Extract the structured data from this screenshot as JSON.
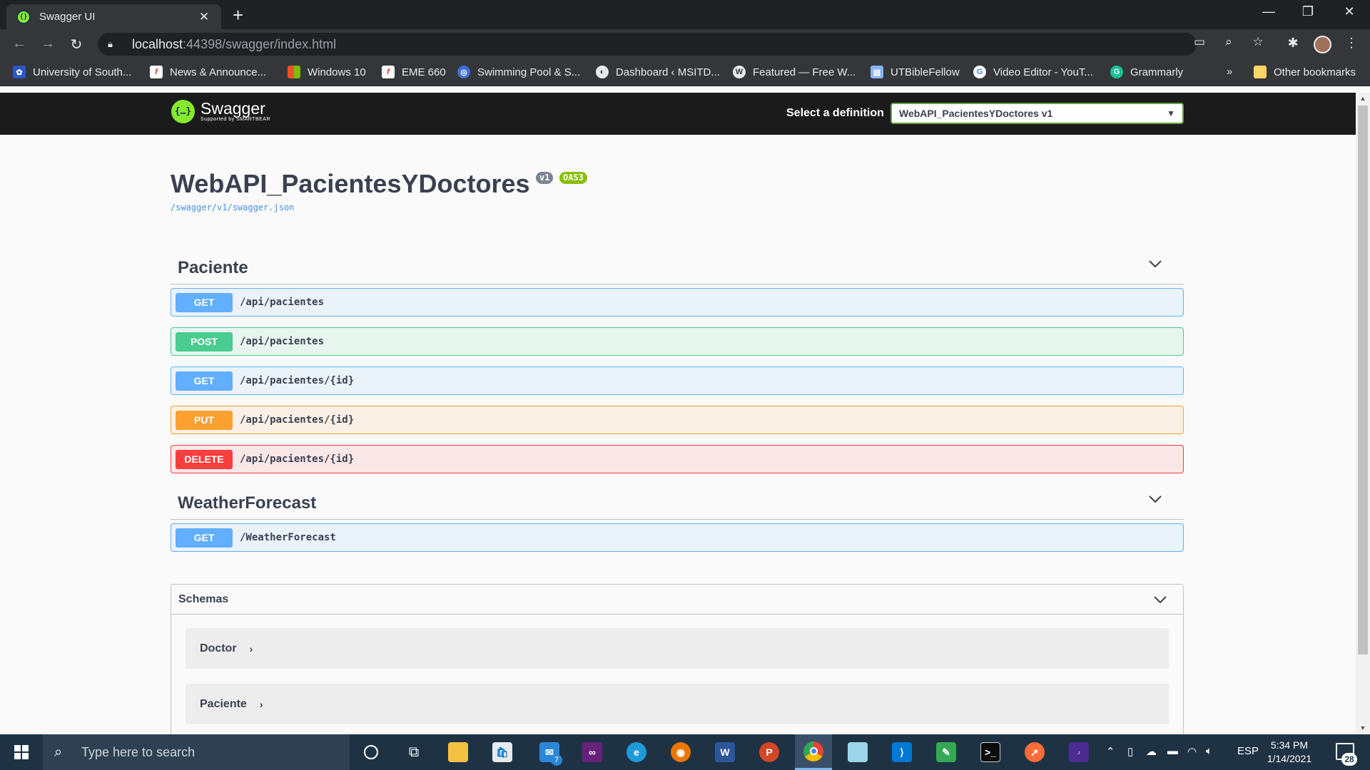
{
  "browser": {
    "tab_title": "Swagger UI",
    "url_host": "localhost",
    "url_rest": ":44398/swagger/index.html",
    "bookmarks": [
      {
        "label": "University of South...",
        "icon": "usf-icon",
        "color": "#2b57c4"
      },
      {
        "label": "News & Announce...",
        "icon": "news-icon",
        "color": "#d93025"
      },
      {
        "label": "Windows 10",
        "icon": "windows-icon",
        "color": "#f25022"
      },
      {
        "label": "EME 660",
        "icon": "course-icon",
        "color": "#d93025"
      },
      {
        "label": "Swimming Pool & S...",
        "icon": "globe-icon",
        "color": "#3c6ed8"
      },
      {
        "label": "Dashboard ‹ MSITD...",
        "icon": "dashboard-icon",
        "color": "#5f6368"
      },
      {
        "label": "Featured — Free W...",
        "icon": "wordpress-icon",
        "color": "#5f6368"
      },
      {
        "label": "UTBibleFellow",
        "icon": "document-icon",
        "color": "#8ab4f8"
      },
      {
        "label": "Video Editor - YouT...",
        "icon": "google-icon",
        "color": "#ffffff"
      },
      {
        "label": "Grammarly",
        "icon": "grammarly-icon",
        "color": "#15c39a"
      }
    ],
    "more_bookmarks": "»",
    "other_bookmarks": "Other bookmarks"
  },
  "swagger": {
    "brand": "Swagger",
    "brand_sub": "Supported by SMARTBEAR",
    "select_label": "Select a definition",
    "select_value": "WebAPI_PacientesYDoctores v1",
    "title": "WebAPI_PacientesYDoctores",
    "version_badge": "v1",
    "oas_badge": "OAS3",
    "spec_link": "/swagger/v1/swagger.json",
    "tags": [
      {
        "name": "Paciente",
        "operations": [
          {
            "method": "GET",
            "path": "/api/pacientes",
            "kind": "get"
          },
          {
            "method": "POST",
            "path": "/api/pacientes",
            "kind": "post"
          },
          {
            "method": "GET",
            "path": "/api/pacientes/{id}",
            "kind": "get"
          },
          {
            "method": "PUT",
            "path": "/api/pacientes/{id}",
            "kind": "put"
          },
          {
            "method": "DELETE",
            "path": "/api/pacientes/{id}",
            "kind": "delete"
          }
        ]
      },
      {
        "name": "WeatherForecast",
        "operations": [
          {
            "method": "GET",
            "path": "/WeatherForecast",
            "kind": "get"
          }
        ]
      }
    ],
    "schemas": {
      "title": "Schemas",
      "models": [
        "Doctor",
        "Paciente"
      ]
    },
    "colors": {
      "get": "#61affe",
      "post": "#49cc90",
      "put": "#fca130",
      "delete": "#f93e3e",
      "brand_green": "#85ea2d"
    }
  },
  "taskbar": {
    "search_placeholder": "Type here to search",
    "mail_badge": "7",
    "language": "ESP",
    "time": "5:34 PM",
    "date": "1/14/2021",
    "notification_count": "28"
  }
}
